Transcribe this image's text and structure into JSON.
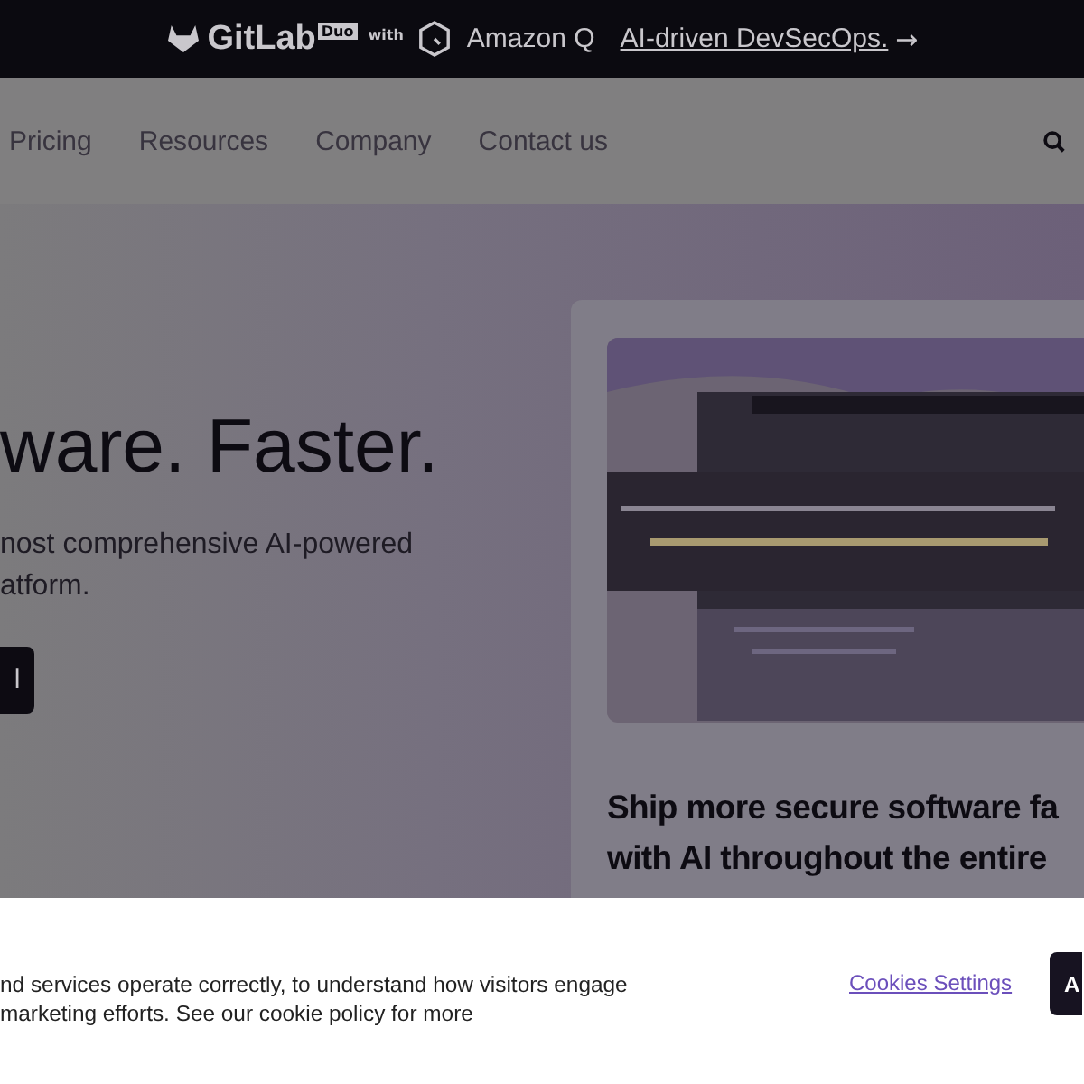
{
  "banner": {
    "brand": "GitLab",
    "badge": "Duo",
    "with": "with",
    "partner": "Amazon Q",
    "link": "AI-driven DevSecOps.",
    "arrow": "→"
  },
  "nav": {
    "items": [
      "Pricing",
      "Resources",
      "Company",
      "Contact us"
    ]
  },
  "hero": {
    "heading": "ware. Faster.",
    "subtitle": [
      "nost comprehensive AI-powered",
      "atform."
    ],
    "button": "l"
  },
  "card": {
    "title": [
      "Ship more secure software fa",
      "with AI throughout the entire"
    ]
  },
  "cookie_banner": {
    "text": [
      "nd services operate correctly, to understand how visitors engage",
      "marketing efforts. See our cookie policy for more"
    ],
    "settings_link": "Cookies Settings",
    "accept_button": "A"
  }
}
